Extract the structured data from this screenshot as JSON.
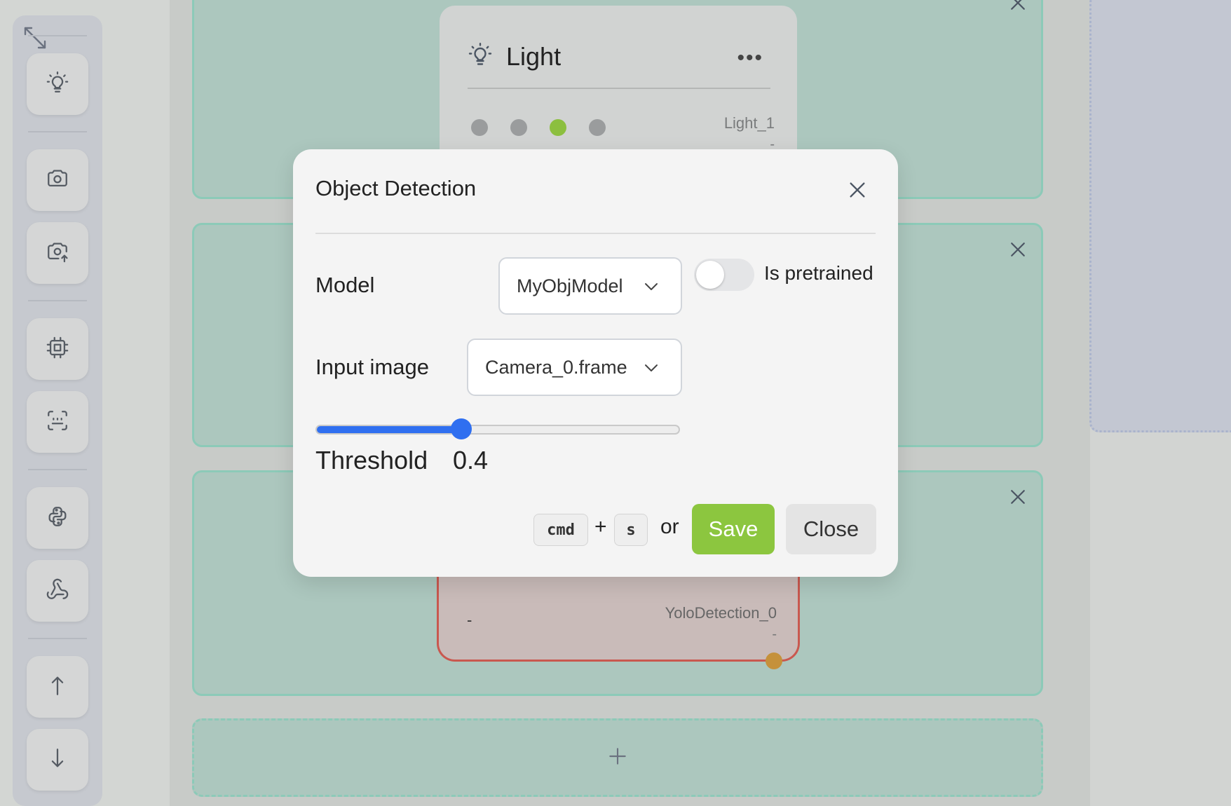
{
  "canvas": {
    "light_node": {
      "title": "Light",
      "more_label": "•••",
      "name": "Light_1",
      "value": "-",
      "dots": [
        {
          "state": "off",
          "color": "#9a9c9d"
        },
        {
          "state": "off",
          "color": "#9a9c9d"
        },
        {
          "state": "on",
          "color": "#8cbf3f"
        },
        {
          "state": "off",
          "color": "#9a9c9d"
        }
      ]
    },
    "yolo_node": {
      "left_value": "-",
      "name": "YoloDetection_0",
      "value": "-"
    }
  },
  "sidebar": {
    "items": [
      {
        "name": "light",
        "icon": "lightbulb-icon"
      },
      {
        "name": "camera",
        "icon": "camera-icon"
      },
      {
        "name": "camera-upload",
        "icon": "camera-upload-icon"
      },
      {
        "name": "processor",
        "icon": "cpu-icon"
      },
      {
        "name": "scan",
        "icon": "scan-icon"
      },
      {
        "name": "python",
        "icon": "python-icon"
      },
      {
        "name": "webhook",
        "icon": "webhook-icon"
      },
      {
        "name": "move-up",
        "icon": "arrow-up-icon"
      },
      {
        "name": "move-down",
        "icon": "arrow-down-icon"
      }
    ]
  },
  "modal": {
    "title": "Object Detection",
    "model": {
      "label": "Model",
      "value": "MyObjModel"
    },
    "pretrained": {
      "label": "Is pretrained",
      "checked": false
    },
    "input_image": {
      "label": "Input image",
      "value": "Camera_0.frame"
    },
    "threshold": {
      "label": "Threshold",
      "value": "0.4",
      "fraction": 0.4
    },
    "shortcut": {
      "key1": "cmd",
      "plus": "+",
      "key2": "s",
      "or": "or"
    },
    "save_label": "Save",
    "close_label": "Close"
  },
  "colors": {
    "accent_blue": "#2f6ff0",
    "save_green": "#8cc63f",
    "group_border": "#8ccab8",
    "node_error_border": "#c9584f"
  }
}
